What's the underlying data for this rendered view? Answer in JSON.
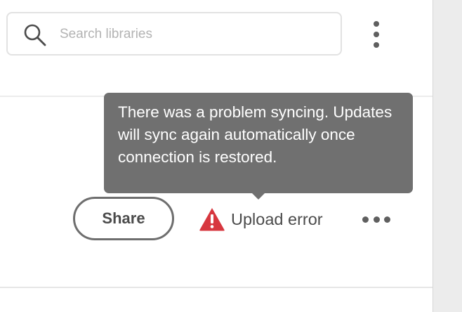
{
  "search": {
    "placeholder": "Search libraries",
    "value": "",
    "icon": "search-icon"
  },
  "header": {
    "menu_icon": "vertical-ellipsis-icon"
  },
  "tooltip": {
    "text": "There was a problem syncing. Updates will sync again automatically once connection is restored."
  },
  "library_item": {
    "share_label": "Share",
    "status_label": "Upload error",
    "status_icon": "warning-triangle-icon",
    "more_icon": "horizontal-ellipsis-icon"
  },
  "colors": {
    "error": "#d7373f",
    "tooltip_bg": "#707070",
    "text": "#4b4b4b"
  }
}
